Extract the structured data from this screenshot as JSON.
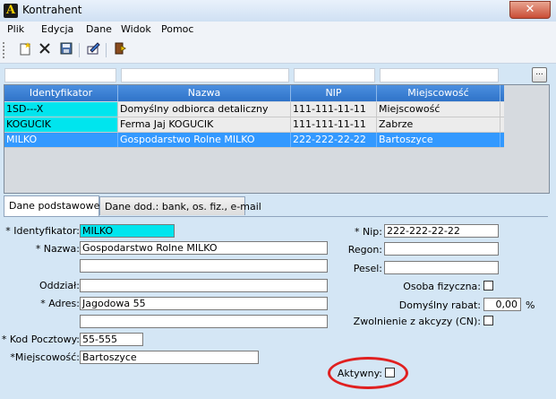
{
  "window": {
    "title": "Kontrahent",
    "app_icon": "A",
    "close_glyph": "✕"
  },
  "menu": [
    "Plik",
    "Edycja",
    "Dane",
    "Widok",
    "Pomoc"
  ],
  "toolbar": {
    "icons": [
      "new-document-icon",
      "delete-icon",
      "save-icon",
      "edit-icon",
      "exit-icon"
    ],
    "filter_button_label": "..."
  },
  "grid": {
    "columns": [
      "Identyfikator",
      "Nazwa",
      "NIP",
      "Miejscowość"
    ],
    "rows": [
      {
        "id": "1SD---X",
        "name": "Domyślny odbiorca detaliczny",
        "nip": "111-111-11-11",
        "city": "Miejscowość",
        "selected": false
      },
      {
        "id": "KOGUCIK",
        "name": "Ferma Jaj KOGUCIK",
        "nip": "111-111-11-11",
        "city": "Zabrze",
        "selected": false
      },
      {
        "id": "MILKO",
        "name": "Gospodarstwo Rolne MILKO",
        "nip": "222-222-22-22",
        "city": "Bartoszyce",
        "selected": true
      }
    ],
    "selection_color": "#3399ff",
    "id_highlight_color": "#00e5ee"
  },
  "tabs": [
    "Dane podstawowe",
    "Dane dod.: bank, os. fiz., e-mail"
  ],
  "form": {
    "identyfikator_label": "* Identyfikator:",
    "identyfikator_value": "MILKO",
    "nazwa_label": "* Nazwa:",
    "nazwa_value": "Gospodarstwo Rolne MILKO",
    "nazwa2_value": "",
    "oddzial_label": "Oddział:",
    "oddzial_value": "",
    "adres_label": "* Adres:",
    "adres_value": "Jagodowa 55",
    "adres2_value": "",
    "kod_label": "* Kod Pocztowy:",
    "kod_value": "55-555",
    "miejscowosc_label": "*Miejscowość:",
    "miejscowosc_value": "Bartoszyce",
    "nip_label": "* Nip:",
    "nip_value": "222-222-22-22",
    "regon_label": "Regon:",
    "regon_value": "",
    "pesel_label": "Pesel:",
    "pesel_value": "",
    "osoba_label": "Osoba fizyczna:",
    "osoba_checked": false,
    "rabat_label": "Domyślny rabat:",
    "rabat_value": "0,00",
    "rabat_unit": "%",
    "zwolnienie_label": "Zwolnienie z akcyzy (CN):",
    "zwolnienie_checked": false,
    "aktywny_label": "Aktywny:",
    "aktywny_checked": false
  }
}
